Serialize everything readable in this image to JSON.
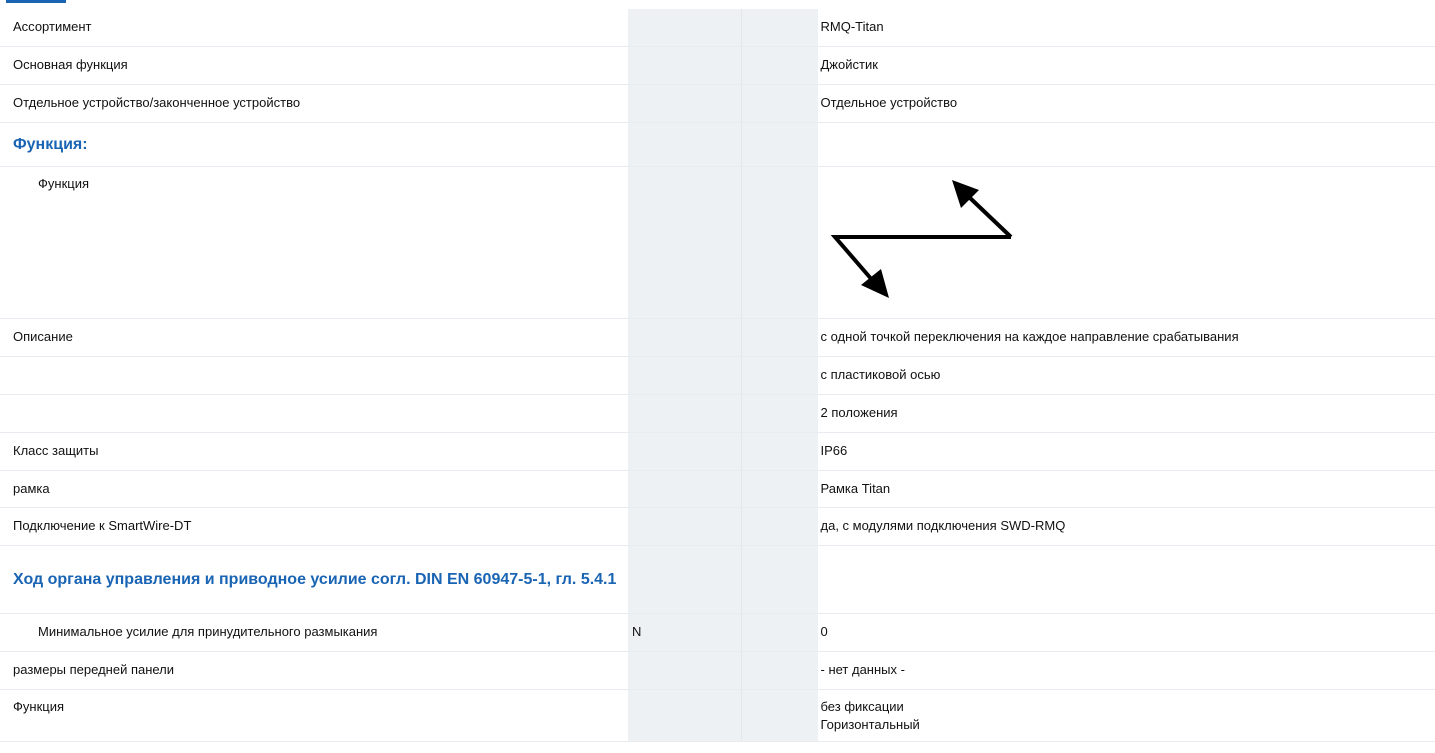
{
  "rows": [
    {
      "label": "Ассортимент",
      "unit": "",
      "value": "RMQ-Titan"
    },
    {
      "label": "Основная функция",
      "unit": "",
      "value": "Джойстик"
    },
    {
      "label": "Отдельное устройство/законченное устройство",
      "unit": "",
      "value": "Отдельное устройство"
    }
  ],
  "section_function": {
    "title": "Функция:"
  },
  "function_row": {
    "label": "Функция",
    "icon": "joystick-function-arrows-icon"
  },
  "rows2": [
    {
      "label": "Описание",
      "unit": "",
      "value": "с одной точкой переключения на каждое направление срабатывания"
    },
    {
      "label": "",
      "unit": "",
      "value": "с пластиковой осью"
    },
    {
      "label": "",
      "unit": "",
      "value": "2 положения"
    },
    {
      "label": "Класс защиты",
      "unit": "",
      "value": "IP66"
    },
    {
      "label": "рамка",
      "unit": "",
      "value": "Рамка Titan"
    },
    {
      "label": "Подключение к SmartWire-DT",
      "unit": "",
      "value": "да, с модулями подключения SWD-RMQ"
    }
  ],
  "section_travel": {
    "title": "Ход органа управления и приводное усилие согл. DIN EN 60947-5-1, гл. 5.4.1"
  },
  "rows3": [
    {
      "label": "Минимальное усилие для принудительного размыкания",
      "unit": "N",
      "value": "0"
    },
    {
      "label": "размеры передней панели",
      "unit": "",
      "value": "- нет данных -"
    }
  ],
  "last_row": {
    "label": "Функция",
    "unit": "",
    "values": [
      "без фиксации",
      "Горизонтальный"
    ]
  },
  "colors": {
    "accent": "#1a64b4",
    "shade": "#eef1f4",
    "border": "#e8ebef"
  }
}
